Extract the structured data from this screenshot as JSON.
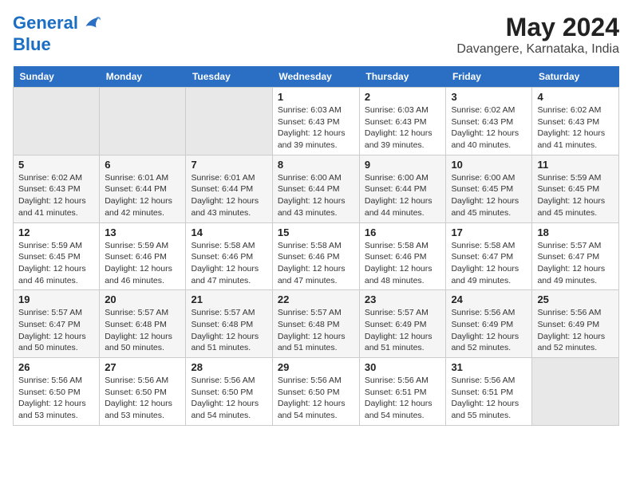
{
  "logo": {
    "line1": "General",
    "line2": "Blue"
  },
  "title": "May 2024",
  "subtitle": "Davangere, Karnataka, India",
  "weekdays": [
    "Sunday",
    "Monday",
    "Tuesday",
    "Wednesday",
    "Thursday",
    "Friday",
    "Saturday"
  ],
  "weeks": [
    [
      {
        "num": "",
        "info": ""
      },
      {
        "num": "",
        "info": ""
      },
      {
        "num": "",
        "info": ""
      },
      {
        "num": "1",
        "info": "Sunrise: 6:03 AM\nSunset: 6:43 PM\nDaylight: 12 hours\nand 39 minutes."
      },
      {
        "num": "2",
        "info": "Sunrise: 6:03 AM\nSunset: 6:43 PM\nDaylight: 12 hours\nand 39 minutes."
      },
      {
        "num": "3",
        "info": "Sunrise: 6:02 AM\nSunset: 6:43 PM\nDaylight: 12 hours\nand 40 minutes."
      },
      {
        "num": "4",
        "info": "Sunrise: 6:02 AM\nSunset: 6:43 PM\nDaylight: 12 hours\nand 41 minutes."
      }
    ],
    [
      {
        "num": "5",
        "info": "Sunrise: 6:02 AM\nSunset: 6:43 PM\nDaylight: 12 hours\nand 41 minutes."
      },
      {
        "num": "6",
        "info": "Sunrise: 6:01 AM\nSunset: 6:44 PM\nDaylight: 12 hours\nand 42 minutes."
      },
      {
        "num": "7",
        "info": "Sunrise: 6:01 AM\nSunset: 6:44 PM\nDaylight: 12 hours\nand 43 minutes."
      },
      {
        "num": "8",
        "info": "Sunrise: 6:00 AM\nSunset: 6:44 PM\nDaylight: 12 hours\nand 43 minutes."
      },
      {
        "num": "9",
        "info": "Sunrise: 6:00 AM\nSunset: 6:44 PM\nDaylight: 12 hours\nand 44 minutes."
      },
      {
        "num": "10",
        "info": "Sunrise: 6:00 AM\nSunset: 6:45 PM\nDaylight: 12 hours\nand 45 minutes."
      },
      {
        "num": "11",
        "info": "Sunrise: 5:59 AM\nSunset: 6:45 PM\nDaylight: 12 hours\nand 45 minutes."
      }
    ],
    [
      {
        "num": "12",
        "info": "Sunrise: 5:59 AM\nSunset: 6:45 PM\nDaylight: 12 hours\nand 46 minutes."
      },
      {
        "num": "13",
        "info": "Sunrise: 5:59 AM\nSunset: 6:46 PM\nDaylight: 12 hours\nand 46 minutes."
      },
      {
        "num": "14",
        "info": "Sunrise: 5:58 AM\nSunset: 6:46 PM\nDaylight: 12 hours\nand 47 minutes."
      },
      {
        "num": "15",
        "info": "Sunrise: 5:58 AM\nSunset: 6:46 PM\nDaylight: 12 hours\nand 47 minutes."
      },
      {
        "num": "16",
        "info": "Sunrise: 5:58 AM\nSunset: 6:46 PM\nDaylight: 12 hours\nand 48 minutes."
      },
      {
        "num": "17",
        "info": "Sunrise: 5:58 AM\nSunset: 6:47 PM\nDaylight: 12 hours\nand 49 minutes."
      },
      {
        "num": "18",
        "info": "Sunrise: 5:57 AM\nSunset: 6:47 PM\nDaylight: 12 hours\nand 49 minutes."
      }
    ],
    [
      {
        "num": "19",
        "info": "Sunrise: 5:57 AM\nSunset: 6:47 PM\nDaylight: 12 hours\nand 50 minutes."
      },
      {
        "num": "20",
        "info": "Sunrise: 5:57 AM\nSunset: 6:48 PM\nDaylight: 12 hours\nand 50 minutes."
      },
      {
        "num": "21",
        "info": "Sunrise: 5:57 AM\nSunset: 6:48 PM\nDaylight: 12 hours\nand 51 minutes."
      },
      {
        "num": "22",
        "info": "Sunrise: 5:57 AM\nSunset: 6:48 PM\nDaylight: 12 hours\nand 51 minutes."
      },
      {
        "num": "23",
        "info": "Sunrise: 5:57 AM\nSunset: 6:49 PM\nDaylight: 12 hours\nand 51 minutes."
      },
      {
        "num": "24",
        "info": "Sunrise: 5:56 AM\nSunset: 6:49 PM\nDaylight: 12 hours\nand 52 minutes."
      },
      {
        "num": "25",
        "info": "Sunrise: 5:56 AM\nSunset: 6:49 PM\nDaylight: 12 hours\nand 52 minutes."
      }
    ],
    [
      {
        "num": "26",
        "info": "Sunrise: 5:56 AM\nSunset: 6:50 PM\nDaylight: 12 hours\nand 53 minutes."
      },
      {
        "num": "27",
        "info": "Sunrise: 5:56 AM\nSunset: 6:50 PM\nDaylight: 12 hours\nand 53 minutes."
      },
      {
        "num": "28",
        "info": "Sunrise: 5:56 AM\nSunset: 6:50 PM\nDaylight: 12 hours\nand 54 minutes."
      },
      {
        "num": "29",
        "info": "Sunrise: 5:56 AM\nSunset: 6:50 PM\nDaylight: 12 hours\nand 54 minutes."
      },
      {
        "num": "30",
        "info": "Sunrise: 5:56 AM\nSunset: 6:51 PM\nDaylight: 12 hours\nand 54 minutes."
      },
      {
        "num": "31",
        "info": "Sunrise: 5:56 AM\nSunset: 6:51 PM\nDaylight: 12 hours\nand 55 minutes."
      },
      {
        "num": "",
        "info": ""
      }
    ]
  ]
}
